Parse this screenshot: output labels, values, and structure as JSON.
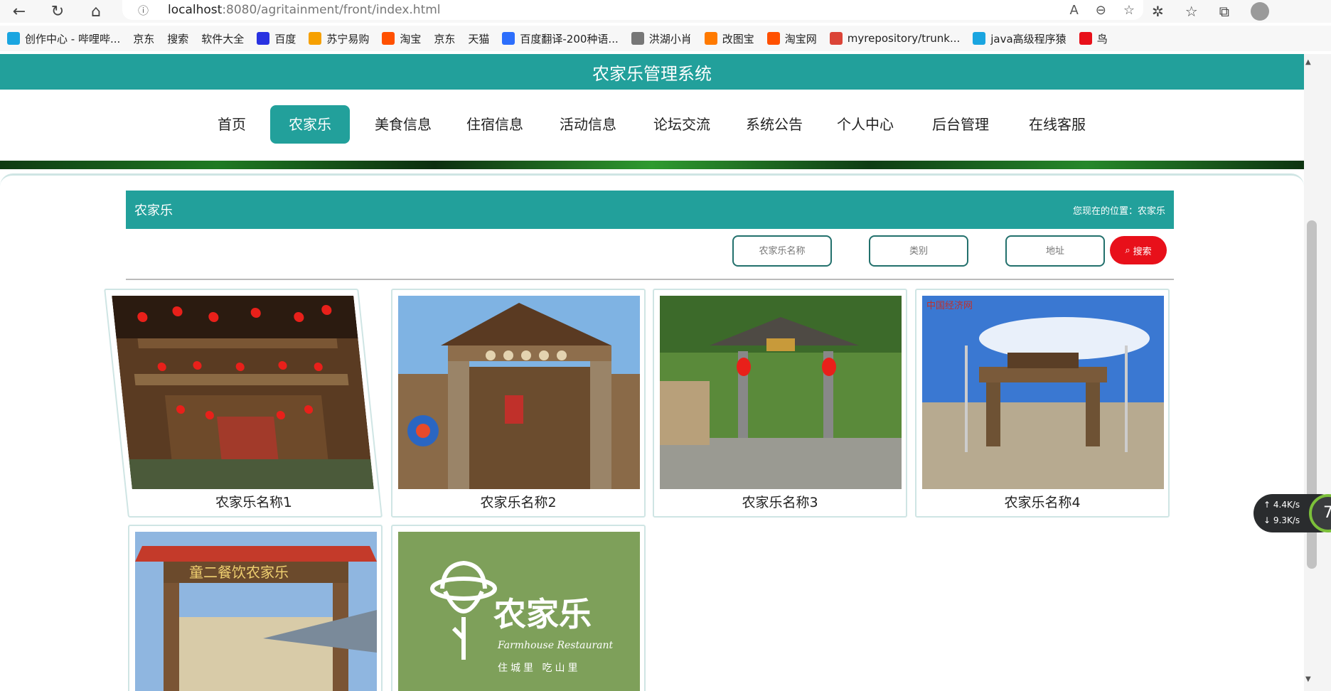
{
  "browser": {
    "url_host": "localhost",
    "url_rest": ":8080/agritainment/front/index.html",
    "bookmarks": [
      {
        "label": "创作中心 - 哔哩哔...",
        "icon": "bilibili-icon",
        "color": "#1aa5e0"
      },
      {
        "label": "京东",
        "icon": "page-icon"
      },
      {
        "label": "搜索",
        "icon": "page-icon"
      },
      {
        "label": "软件大全",
        "icon": "page-icon"
      },
      {
        "label": "百度",
        "icon": "baidu-icon",
        "color": "#2932e1"
      },
      {
        "label": "苏宁易购",
        "icon": "suning-icon",
        "color": "#f6a000"
      },
      {
        "label": "淘宝",
        "icon": "taobao-icon",
        "color": "#ff5000"
      },
      {
        "label": "京东",
        "icon": "page-icon"
      },
      {
        "label": "天猫",
        "icon": "page-icon"
      },
      {
        "label": "百度翻译-200种语...",
        "icon": "translate-icon",
        "color": "#2c6efc"
      },
      {
        "label": "洪湖小肖",
        "icon": "bird-icon",
        "color": "#777777"
      },
      {
        "label": "改图宝",
        "icon": "gaitubao-icon",
        "color": "#ff7a00"
      },
      {
        "label": "淘宝网",
        "icon": "taobao-icon",
        "color": "#ff5000"
      },
      {
        "label": "myrepository/trunk...",
        "icon": "chrome-icon",
        "color": "#db4437"
      },
      {
        "label": "java高级程序猿",
        "icon": "bilibili-icon",
        "color": "#1aa5e0"
      },
      {
        "label": "鸟",
        "icon": "bird-icon",
        "color": "#e8101a"
      }
    ]
  },
  "site": {
    "title": "农家乐管理系统",
    "nav": [
      "首页",
      "农家乐",
      "美食信息",
      "住宿信息",
      "活动信息",
      "论坛交流",
      "系统公告",
      "个人中心",
      "后台管理",
      "在线客服"
    ],
    "active_nav": "农家乐"
  },
  "section": {
    "title": "农家乐",
    "breadcrumb": "您现在的位置：农家乐"
  },
  "search": {
    "name_placeholder": "农家乐名称",
    "category_placeholder": "类别",
    "address_placeholder": "地址",
    "button_label": "搜索"
  },
  "cards": [
    {
      "name": "农家乐名称1",
      "image": "courtyard with red lanterns"
    },
    {
      "name": "农家乐名称2",
      "image": "rustic wooden gate with corn"
    },
    {
      "name": "农家乐名称3",
      "image": "pavilion with lanterns"
    },
    {
      "name": "农家乐名称4",
      "image": "folk village archway"
    },
    {
      "name": "",
      "image": "red roof farmhouse gate",
      "sign_text": "童二餐饮农家乐"
    },
    {
      "name": "",
      "image": "farmhouse restaurant logo",
      "logo_title": "农家乐",
      "logo_sub": "Farmhouse Restaurant",
      "logo_tag": "住城里  吃山里"
    }
  ],
  "speed_widget": {
    "up": "4.4K/s",
    "down": "9.3K/s",
    "badge": "7"
  },
  "colors": {
    "primary": "#22a09b",
    "search_button": "#e8101a"
  }
}
